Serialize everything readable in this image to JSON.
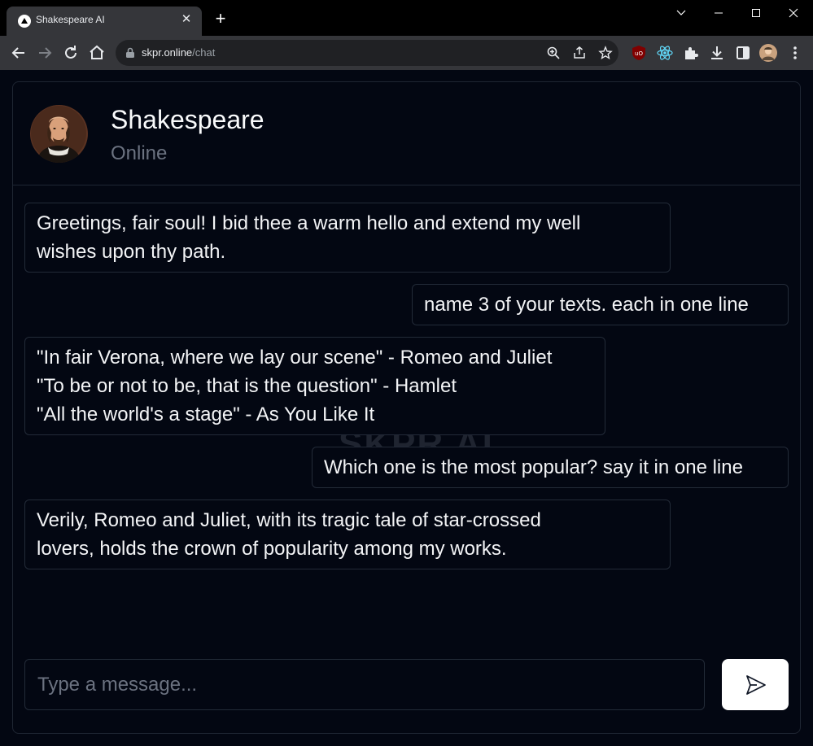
{
  "browser": {
    "tab_title": "Shakespeare AI",
    "tab_close": "✕",
    "new_tab": "+",
    "url_host": "skpr.online",
    "url_path": "/chat"
  },
  "chat": {
    "bot_name": "Shakespeare",
    "bot_status": "Online",
    "watermark": "SKPR AI",
    "messages": [
      {
        "role": "assistant",
        "text": "Greetings, fair soul! I bid thee a warm hello and extend my well\nwishes upon thy path."
      },
      {
        "role": "user",
        "text": "name 3 of your texts. each in one line"
      },
      {
        "role": "assistant",
        "text": "\"In fair Verona, where we lay our scene\" - Romeo and Juliet\n\"To be or not to be, that is the question\" - Hamlet\n\"All the world's a stage\" - As You Like It"
      },
      {
        "role": "user",
        "text": "Which one is the most popular? say it in one line"
      },
      {
        "role": "assistant",
        "text": "Verily, Romeo and Juliet, with its tragic tale of star-crossed\nlovers, holds the crown of popularity among my works."
      }
    ],
    "input": {
      "placeholder": "Type a message...",
      "value": ""
    }
  },
  "colors": {
    "page_bg": "#030712",
    "border": "#232b38",
    "text": "#f3f4f6",
    "muted": "#6b7280",
    "send_button": "#ffffff"
  }
}
